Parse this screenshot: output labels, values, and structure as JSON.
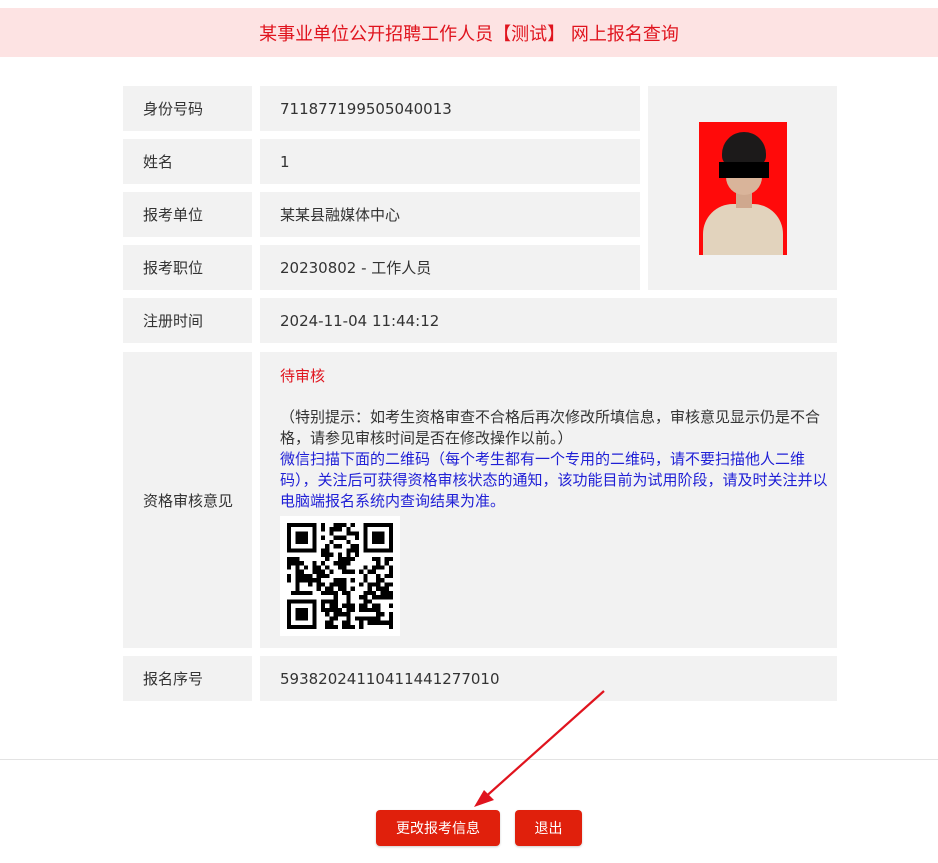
{
  "header": {
    "title": "某事业单位公开招聘工作人员【测试】 网上报名查询"
  },
  "fields": {
    "id_number": {
      "label": "身份号码",
      "value": "711877199505040013"
    },
    "name": {
      "label": "姓名",
      "value": "1"
    },
    "unit": {
      "label": "报考单位",
      "value": "某某县融媒体中心"
    },
    "position": {
      "label": "报考职位",
      "value": "20230802 - 工作人员"
    },
    "register_time": {
      "label": "注册时间",
      "value": "2024-11-04 11:44:12"
    },
    "review": {
      "label": "资格审核意见",
      "status": "待审核",
      "tip": "（特别提示：如考生资格审查不合格后再次修改所填信息，审核意见显示仍是不合格，请参见审核时间是否在修改操作以前。）",
      "wechat": "微信扫描下面的二维码（每个考生都有一个专用的二维码，请不要扫描他人二维码），关注后可获得资格审核状态的通知，该功能目前为试用阶段，请及时关注并以电脑端报名系统内查询结果为准。"
    },
    "serial": {
      "label": "报名序号",
      "value": "59382024110411441277010"
    }
  },
  "buttons": {
    "modify": "更改报考信息",
    "exit": "退出"
  },
  "colors": {
    "accent": "#e0141e",
    "header_bg": "#fde3e3",
    "wechat_text": "#1f1fd6",
    "cell_bg": "#f2f2f2"
  },
  "icons": {
    "photo": "applicant-photo",
    "qr": "wechat-qr-code",
    "arrow": "annotation-arrow"
  }
}
